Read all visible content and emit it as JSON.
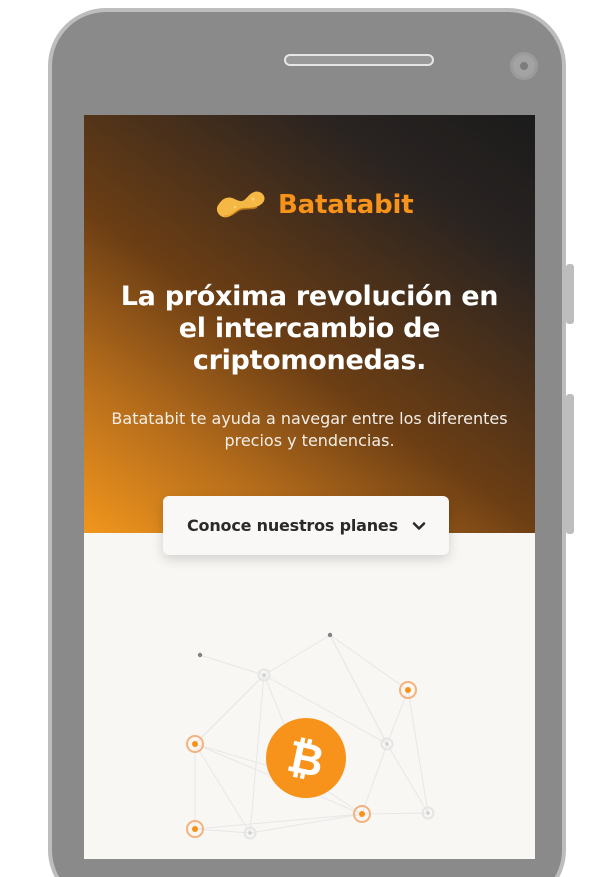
{
  "brand": {
    "name": "Batatabit",
    "icon": "potato-logo-icon",
    "accent_color": "#f7931a"
  },
  "hero": {
    "title": "La próxima revolución en el intercambio de criptomonedas.",
    "subtitle": "Batatabit te ayuda a navegar entre los diferentes precios y tendencias."
  },
  "cta": {
    "label": "Conoce nuestros planes",
    "icon": "chevron-down-icon"
  },
  "illustration": {
    "center_label": "₿",
    "icon": "bitcoin-icon"
  },
  "colors": {
    "hero_dark": "#1b1b1b",
    "hero_orange": "#f1961d",
    "screen_background": "#f8f7f4",
    "button_background": "#f9f8f6"
  }
}
